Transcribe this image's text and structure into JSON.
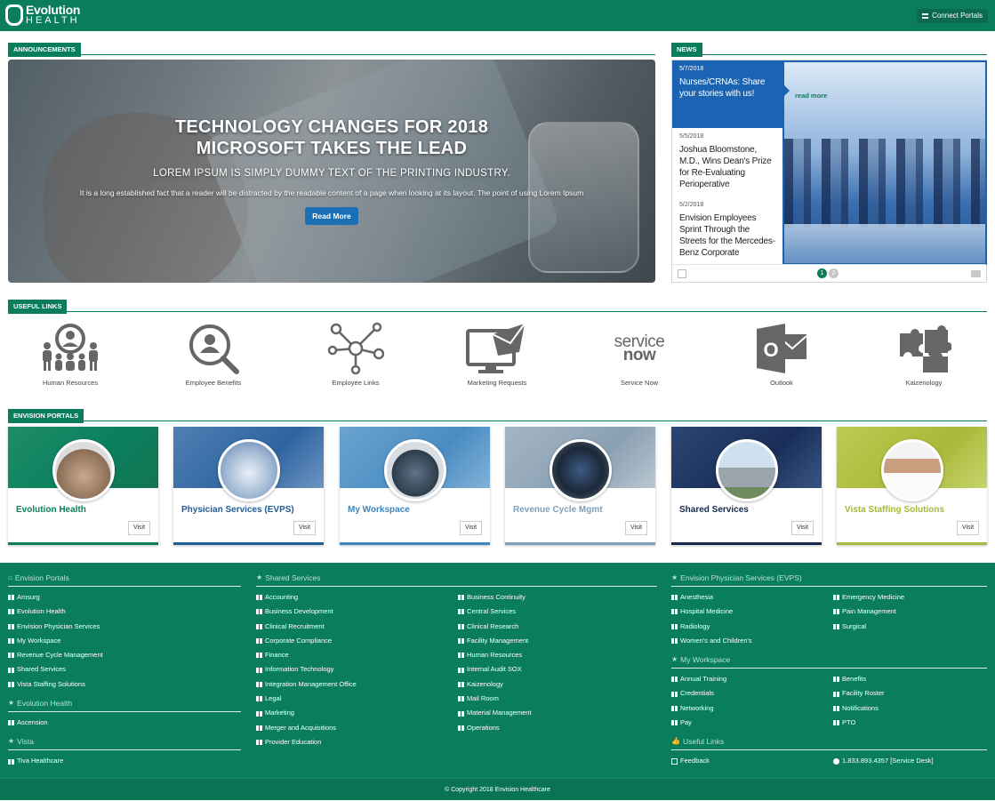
{
  "header": {
    "logo_top": "Evolution",
    "logo_bottom": "HEALTH",
    "connect_label": "Connect Portals"
  },
  "sections": {
    "announcements": "ANNOUNCEMENTS",
    "news": "NEWS",
    "useful_links": "USEFUL LINKS",
    "envision_portals": "ENVISION PORTALS"
  },
  "hero": {
    "title_line1": "TECHNOLOGY CHANGES FOR 2018",
    "title_line2": "MICROSOFT TAKES THE LEAD",
    "subtitle": "LOREM IPSUM IS SIMPLY DUMMY TEXT OF THE PRINTING INDUSTRY.",
    "body": "It is a long established fact that a reader will be distracted by the readable content of a page when looking at its layout. The point of using Lorem Ipsum",
    "button": "Read More"
  },
  "news": {
    "items": [
      {
        "date": "5/7/2018",
        "title": "Nurses/CRNAs: Share your stories with us!"
      },
      {
        "date": "5/5/2018",
        "title": "Joshua Bloomstone, M.D., Wins Dean's Prize for Re-Evaluating Perioperative"
      },
      {
        "date": "5/2/2018",
        "title": "Envision Employees Sprint Through the Streets for the Mercedes-Benz Corporate"
      }
    ],
    "read_more": "read more",
    "pages": [
      "1",
      "2"
    ]
  },
  "useful_links": [
    {
      "label": "Human Resources",
      "icon": "human-resources-icon"
    },
    {
      "label": "Employee Benefits",
      "icon": "employee-benefits-icon"
    },
    {
      "label": "Employee Links",
      "icon": "employee-links-icon"
    },
    {
      "label": "Marketing Requests",
      "icon": "marketing-requests-icon"
    },
    {
      "label": "Service Now",
      "icon": "servicenow-logo-icon"
    },
    {
      "label": "Outlook",
      "icon": "outlook-icon"
    },
    {
      "label": "Kaizenology",
      "icon": "puzzle-icon"
    }
  ],
  "servicenow_text": {
    "line1": "service",
    "line2": "now"
  },
  "outlook_letter": "O",
  "portals": [
    {
      "name": "Evolution Health",
      "visit": "Visit",
      "color": "#0a7e5c"
    },
    {
      "name": "Physician Services (EVPS)",
      "visit": "Visit",
      "color": "#1e5c99"
    },
    {
      "name": "My Workspace",
      "visit": "Visit",
      "color": "#3d86bd"
    },
    {
      "name": "Revenue Cycle Mgmt",
      "visit": "Visit",
      "color": "#7e9fb9"
    },
    {
      "name": "Shared Services",
      "visit": "Visit",
      "color": "#14284c"
    },
    {
      "name": "Vista Staffing Solutions",
      "visit": "Visit",
      "color": "#a8b838"
    }
  ],
  "footer": {
    "envision_portals": {
      "heading": "Envision Portals",
      "items": [
        "Amsurg",
        "Evolution Health",
        "Envision Physician Services",
        "My Workspace",
        "Revenue Cycle Management",
        "Shared Services",
        "Vista Staffing Solutions"
      ]
    },
    "evolution_health": {
      "heading": "Evolution Health",
      "items": [
        "Ascension"
      ]
    },
    "vista": {
      "heading": "Vista",
      "items": [
        "Tiva Healthcare"
      ]
    },
    "shared_services": {
      "heading": "Shared Services",
      "col1": [
        "Accounting",
        "Business Development",
        "Clinical Recruitment",
        "Corporate Compliance",
        "Finance",
        "Information Technology",
        "Integration Management Office",
        "Legal",
        "Marketing",
        "Merger and Acquisitions",
        "Provider Education"
      ],
      "col2": [
        "Business Continuity",
        "Central Services",
        "Clinical Research",
        "Facility Management",
        "Human Resources",
        "Internal Audit SOX",
        "Kaizenology",
        "Mail Room",
        "Material Management",
        "Operations"
      ]
    },
    "evps": {
      "heading": "Envision Physician Services (EVPS)",
      "col1": [
        "Anesthesia",
        "Hospital Medicine",
        "Radiology",
        "Women's and Children's"
      ],
      "col2": [
        "Emergency Medicine",
        "Pain Management",
        "Surgical"
      ]
    },
    "my_workspace": {
      "heading": "My Workspace",
      "col1": [
        "Annual Training",
        "Credentials",
        "Networking",
        "Pay"
      ],
      "col2": [
        "Benefits",
        "Facility Roster",
        "Notifications",
        "PTO"
      ]
    },
    "useful_links": {
      "heading": "Useful Links",
      "feedback": "Feedback",
      "service_desk": "1.833.893.4357 [Service Desk]"
    },
    "copyright": "© Copyright 2018 Envision Healthcare"
  }
}
